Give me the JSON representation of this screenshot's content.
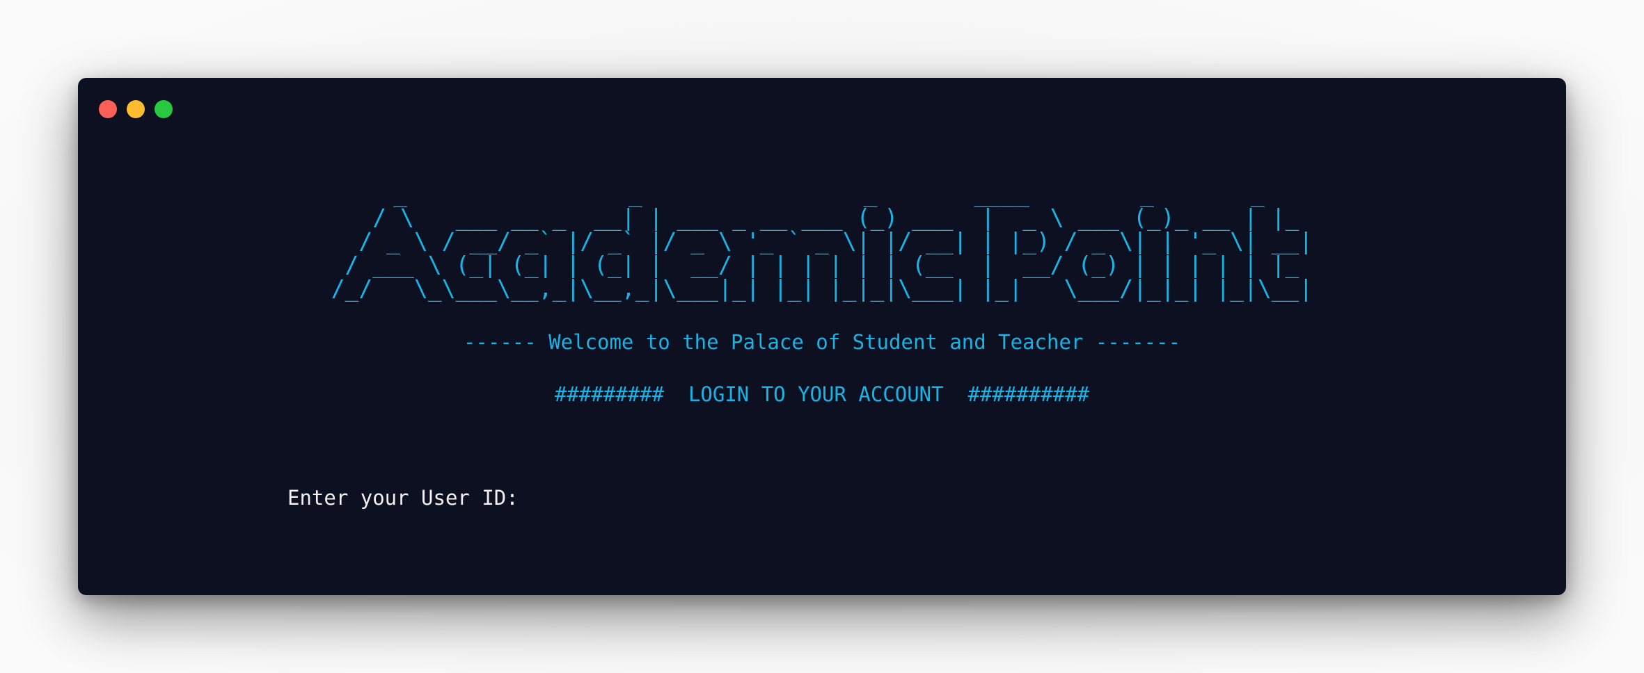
{
  "colors": {
    "window_bg": "#0c1020",
    "accent_cyan": "#19b4e6",
    "prompt_text": "#f0f0f0",
    "close": "#fe5f57",
    "minimize": "#febc2e",
    "zoom": "#28c840"
  },
  "window": {
    "controls": [
      {
        "name": "close-button",
        "color": "#fe5f57"
      },
      {
        "name": "minimize-button",
        "color": "#febc2e"
      },
      {
        "name": "zoom-button",
        "color": "#28c840"
      }
    ]
  },
  "banner": {
    "lines": [
      "    _                _                _       ____        _       _   ",
      "   / \\   ___ __ _  __| | ___ _ __ ___ (_) ___  |  _ \\ ___ (_)_ __ | |_ ",
      "  / _ \\ / __/ _` |/ _` |/ _ \\ '_ ` _ \\| |/ __| | |_) / _ \\| | '_ \\| __|",
      " / ___ \\ (_| (_| | (_| |  __/ | | | | | | (__  |  __/ (_) | | | | | |_ ",
      "/_/   \\_\\___\\__,_|\\__,_|\\___|_| |_| |_|_|\\___| |_|   \\___/|_|_| |_|\\__|"
    ],
    "welcome": "------ Welcome to the Palace of Student and Teacher -------",
    "login_heading": "#########  LOGIN TO YOUR ACCOUNT  ##########"
  },
  "prompt": {
    "label": "Enter your User ID:",
    "value": ""
  }
}
